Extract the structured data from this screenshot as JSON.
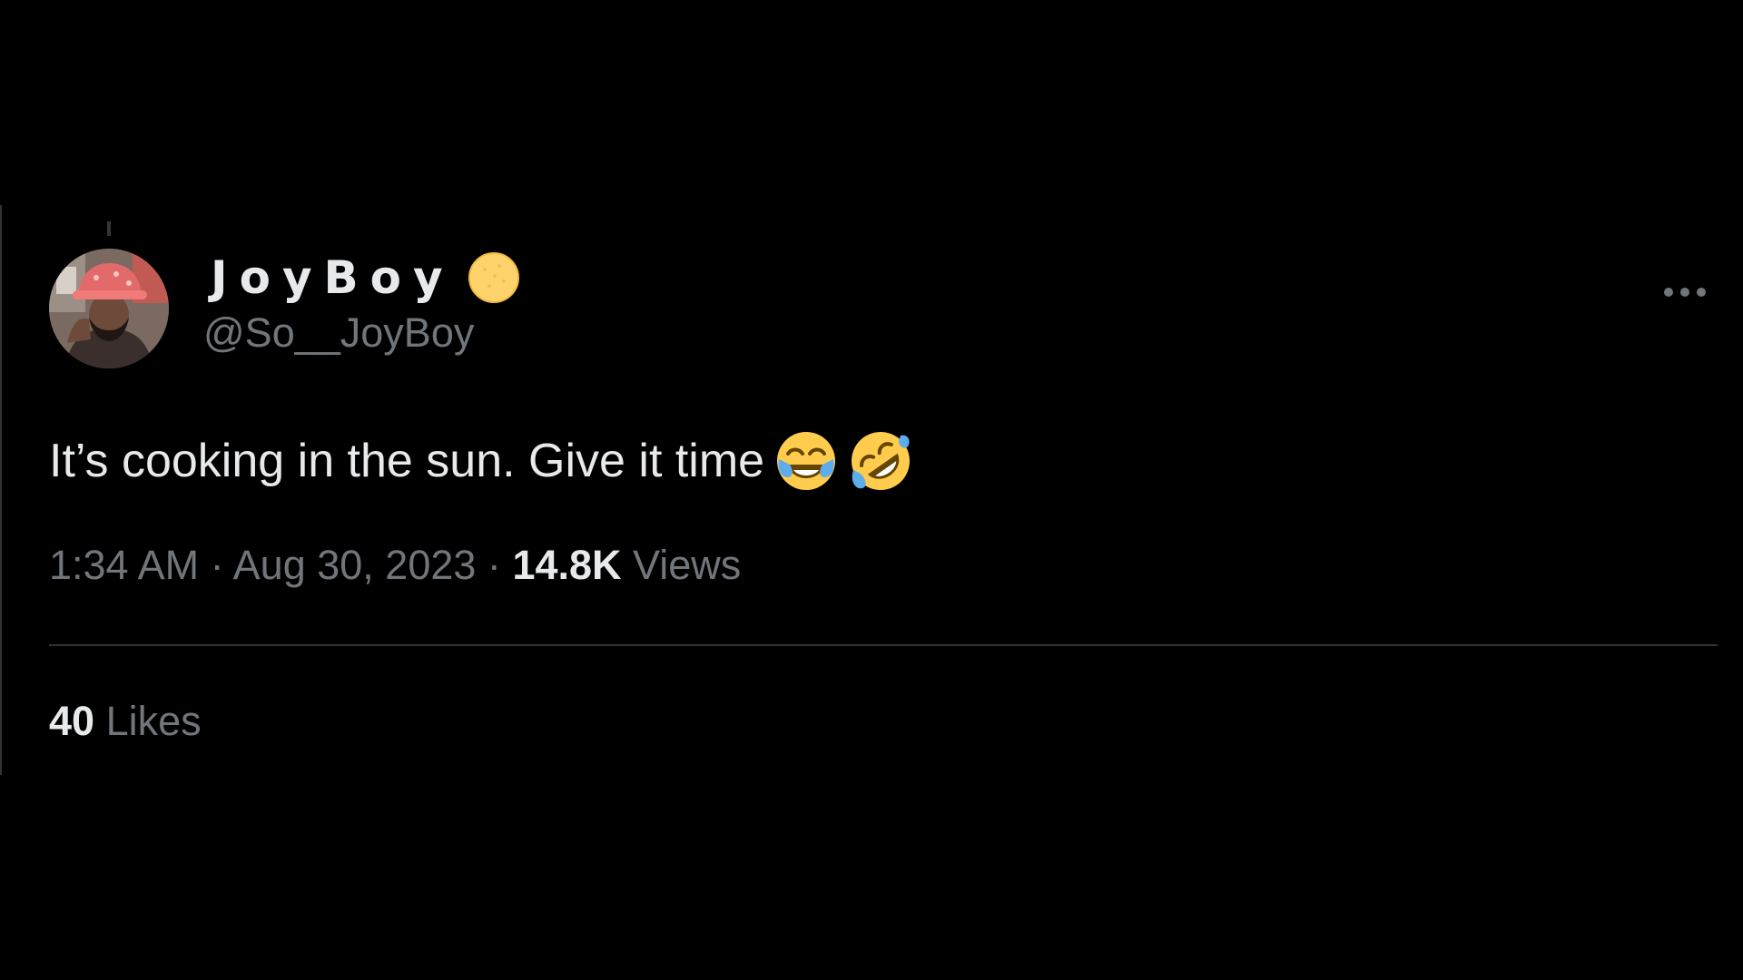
{
  "colors": {
    "background": "#000000",
    "primary_text": "#e7e9ea",
    "secondary_text": "#71767b",
    "divider": "#2f3336",
    "badge": "#ffd36b"
  },
  "tweet": {
    "author": {
      "display_name": "JoyBoy",
      "handle": "@So__JoyBoy",
      "avatar_icon": "avatar",
      "badge_icon": "yellow-circle-emoji"
    },
    "more_icon": "more-options-icon",
    "text": "It’s cooking in the sun. Give it time",
    "emojis": [
      "face-with-tears-of-joy",
      "rolling-on-the-floor-laughing"
    ],
    "timestamp": {
      "time": "1:34 AM",
      "separator": "·",
      "date": "Aug 30, 2023"
    },
    "views": {
      "count": "14.8K",
      "label": "Views"
    },
    "likes": {
      "count": "40",
      "label": "Likes"
    }
  }
}
